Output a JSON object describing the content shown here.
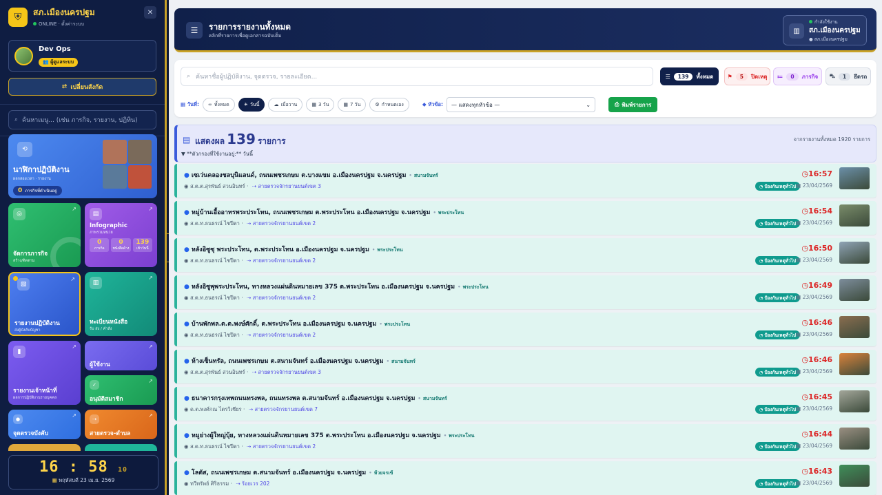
{
  "sidebar": {
    "brand": "สภ.เมืองนครปฐม",
    "status": "ONLINE · ตั้งค่าระบบ",
    "user_name": "Dev Ops",
    "user_role": "ผู้ดูแลระบบ",
    "switch_label": "เปลี่ยนสังกัด",
    "search_placeholder": "ค้นหาเมนู... (เช่น ภารกิจ, รายงาน, ปฏิทิน)",
    "tiles": {
      "timeline_title": "นาฬิกาปฏิบัติงาน",
      "timeline_sub": "ผลกล่องเวลา · รายงาน",
      "timeline_badge": "ภารกิจที่ดำเนินอยู่",
      "timeline_count": "0",
      "mission_title": "จัดการภารกิจ",
      "mission_sub": "สร้าง/ติดตาม",
      "info_title": "Infographic",
      "info_sub": "ภาพรวมหน่วย",
      "info_stats": [
        {
          "value": "0",
          "label": "ภารกิจ"
        },
        {
          "value": "0",
          "label": "หนังสือค้าง"
        },
        {
          "value": "139",
          "label": "เข้าวันนี้"
        }
      ],
      "report_title": "รายงานปฏิบัติงาน",
      "report_sub": "ส่งผู้บังคับบัญชา",
      "book_title": "ทะเบียนหนังสือ",
      "book_sub": "รับ ส่ง / คำสั่ง",
      "officer_title": "รายงานเจ้าหน้าที่",
      "officer_sub": "ผลการปฏิบัติงานรายบุคคล",
      "users_title": "ผู้ใช้งาน",
      "approve_title": "อนุมัติสมาชิก",
      "checkpoint_title": "จุดตรวจบังคับ",
      "patrol_title": "สายตรวจ-ตำบล"
    },
    "clock_time": "16 : 58",
    "clock_sec": "10",
    "clock_date": "พฤหัสบดี 23 เม.ย. 2569"
  },
  "header": {
    "title": "รายการรายงานทั้งหมด",
    "subtitle": "คลิกที่รายการเพื่อดูเอกสารฉบับเต็ม",
    "loc_label": "กำลังใช้งาน",
    "loc_name": "สภ.เมืองนครปฐม",
    "loc_sub": "สภ.เมืองนครปฐม"
  },
  "filters": {
    "search_placeholder": "ค้นหาชื่อผู้ปฏิบัติงาน, จุดตรวจ, รายละเอียด...",
    "counts": [
      {
        "label": "ทั้งหมด",
        "count": "139",
        "icon": "list-icon"
      },
      {
        "label": "ปิดเหตุ",
        "count": "5",
        "icon": "flag-icon"
      },
      {
        "label": "ภารกิจ",
        "count": "0",
        "icon": "tasks-icon"
      },
      {
        "label": "ยึดรถ",
        "count": "1",
        "icon": "car-icon"
      }
    ],
    "date_label": "วันที่:",
    "date_chips": [
      "ทั้งหมด",
      "วันนี้",
      "เมื่อวาน",
      "3 วัน",
      "7 วัน",
      "กำหนดเอง"
    ],
    "topic_label": "หัวข้อ:",
    "topic_value": "— แสดงทุกหัวข้อ —",
    "print_label": "พิมพ์รายการ"
  },
  "results": {
    "prefix": "แสดงผล",
    "count": "139",
    "suffix": "รายการ",
    "total_text": "จากรายงานทั้งหมด 1920 รายการ",
    "filter_text": "**ตัวกรองที่ใช้งานอยู่:** วันนี้"
  },
  "records": [
    {
      "location": "เซเว่นคลองชลบุนิแลนด์, ถนนเพชรเกษม ต.บางแขม อ.เมืองนครปฐม จ.นครปฐม",
      "tag": "สนามจันทร์",
      "officer": "ส.ต.ต.สุรพันธ์ สวนอินทร์",
      "route": "สายตรวจจักรยานยนต์เขต 3",
      "time": "16:57",
      "badge": "ป้องกันเหตุทั่วไป",
      "date": "23/04/2569",
      "thumb": "#6b8fa8"
    },
    {
      "location": "หมู่บ้านเอื้ออาทรพระประโทน, ถนนเพชรเกษม ต.พระประโทน อ.เมืองนครปฐม จ.นครปฐม",
      "tag": "พระประโทน",
      "officer": "ส.ต.ท.ธนธรณ์ ไชปีตา",
      "route": "สายตรวจจักรยานยนต์เขต 2",
      "time": "16:54",
      "badge": "ป้องกันเหตุทั่วไป",
      "date": "23/04/2569",
      "thumb": "#7a8c6a"
    },
    {
      "location": "หลังอิซูซุ พระประโทน, ต.พระประโทน อ.เมืองนครปฐม จ.นครปฐม",
      "tag": "พระประโทน",
      "officer": "ส.ต.ท.ธนธรณ์ ไชปีตา",
      "route": "สายตรวจจักรยานยนต์เขต 2",
      "time": "16:50",
      "badge": "ป้องกันเหตุทั่วไป",
      "date": "23/04/2569",
      "thumb": "#8fa3b5"
    },
    {
      "location": "หลังอิซูพุพระประโทน, ทางหลวงแผ่นดินหมายเลข 375 ต.พระประโทน อ.เมืองนครปฐม จ.นครปฐม",
      "tag": "พระประโทน",
      "officer": "ส.ต.ท.ธนธรณ์ ไชปีตา",
      "route": "สายตรวจจักรยานยนต์เขต 2",
      "time": "16:49",
      "badge": "ป้องกันเหตุทั่วไป",
      "date": "23/04/2569",
      "thumb": "#7d8d9c"
    },
    {
      "location": "บ้านพักพล.ต.ต.พงษ์ศักดิ์, ต.พระประโทน อ.เมืองนครปฐม จ.นครปฐม",
      "tag": "พระประโทน",
      "officer": "ส.ต.ท.ธนธรณ์ ไชปีตา",
      "route": "สายตรวจจักรยานยนต์เขต 2",
      "time": "16:46",
      "badge": "ป้องกันเหตุทั่วไป",
      "date": "23/04/2569",
      "thumb": "#8a6d4f"
    },
    {
      "location": "ห้างเซ็นทรัล, ถนนเพชรเกษม ต.สนามจันทร์ อ.เมืองนครปฐม จ.นครปฐม",
      "tag": "สนามจันทร์",
      "officer": "ส.ต.ต.สุรพันธ์ สวนอินทร์",
      "route": "สายตรวจจักรยานยนต์เขต 3",
      "time": "16:46",
      "badge": "ป้องกันเหตุทั่วไป",
      "date": "23/04/2569",
      "thumb": "#d9823b"
    },
    {
      "location": "ธนาคารกรุงเทพถนนทรงพล, ถนนทรงพล ต.สนามจันทร์ อ.เมืองนครปฐม จ.นครปฐม",
      "tag": "สนามจันทร์",
      "officer": "ด.ต.พงศ์กณ ไตรวิเชียร",
      "route": "สายตรวจจักรยานยนต์เขต 7",
      "time": "16:45",
      "badge": "ป้องกันเหตุทั่วไป",
      "date": "23/04/2569",
      "thumb": "#a3a69a"
    },
    {
      "location": "หมูย่างผู้ใหญ่บุ้ย, ทางหลวงแผ่นดินหมายเลข 375 ต.พระประโทน อ.เมืองนครปฐม จ.นครปฐม",
      "tag": "พระประโทน",
      "officer": "ส.ต.ท.ธนธรณ์ ไชปีตา",
      "route": "สายตรวจจักรยานยนต์เขต 2",
      "time": "16:44",
      "badge": "ป้องกันเหตุทั่วไป",
      "date": "23/04/2569",
      "thumb": "#9a8f82"
    },
    {
      "location": "โลตัส, ถนนเพชรเกษม ต.สนามจันทร์ อ.เมืองนครปฐม จ.นครปฐม",
      "tag": "ห้วยจรเข้",
      "officer": "ทวีทรัพย์ ศิริธรรม",
      "route": "ร้อยเวร 202",
      "time": "16:43",
      "badge": "ป้องกันเหตุทั่วไป",
      "date": "23/04/2569",
      "thumb": "#3f8f5a"
    }
  ]
}
